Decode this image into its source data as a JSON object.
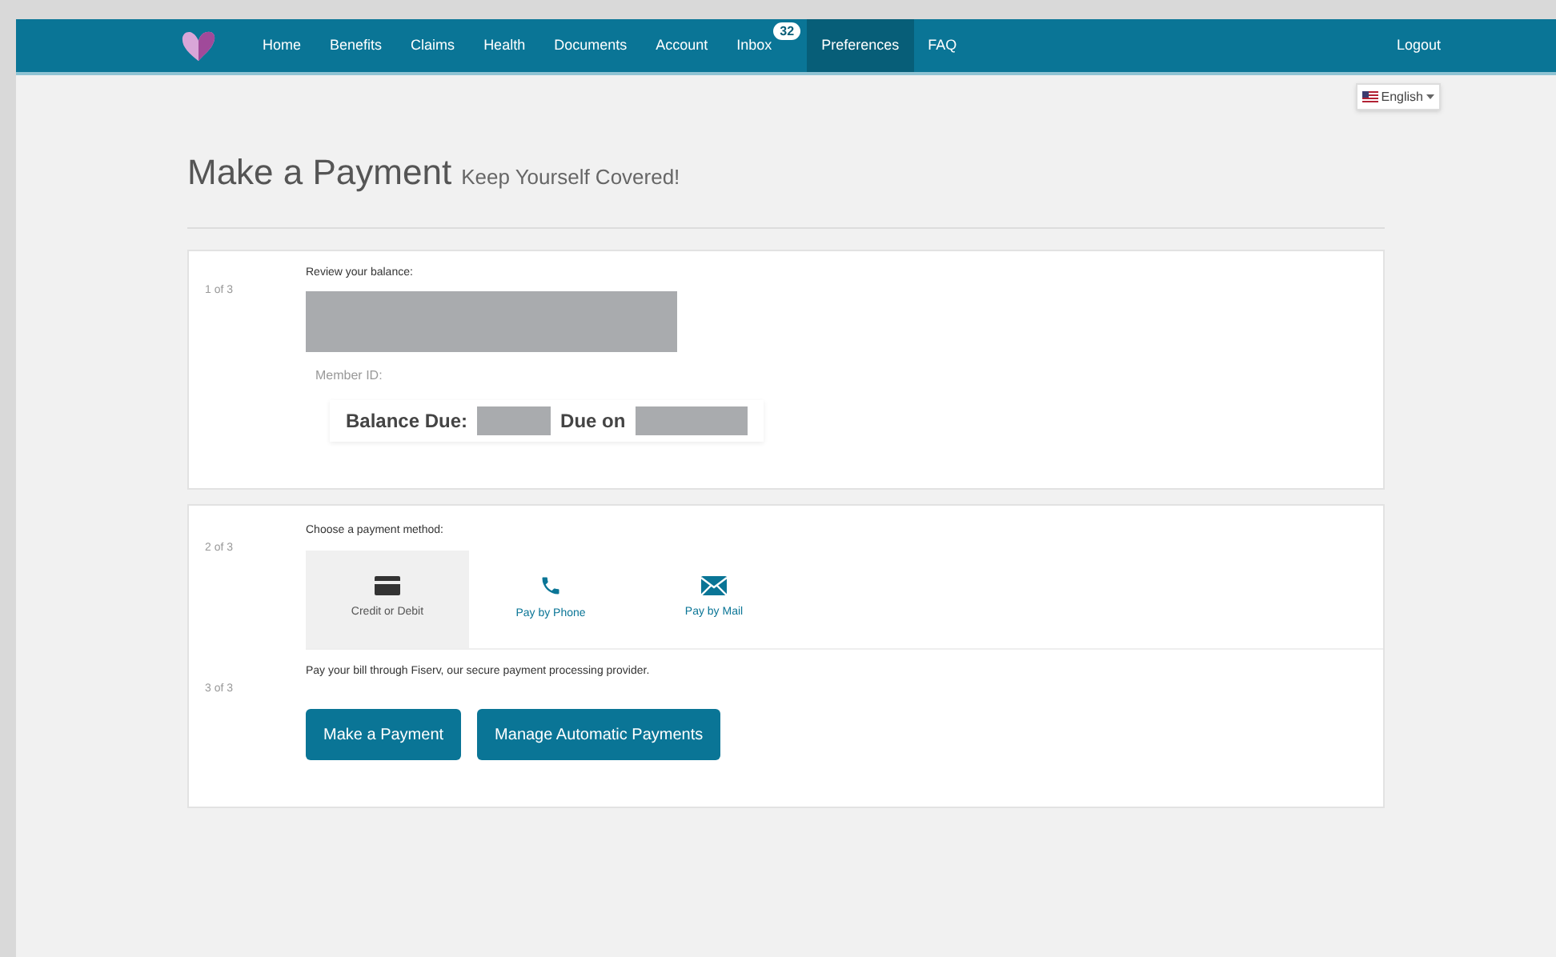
{
  "nav": {
    "items": [
      {
        "label": "Home",
        "selected": false
      },
      {
        "label": "Benefits",
        "selected": false
      },
      {
        "label": "Claims",
        "selected": false
      },
      {
        "label": "Health",
        "selected": false
      },
      {
        "label": "Documents",
        "selected": false
      },
      {
        "label": "Account",
        "selected": false
      },
      {
        "label": "Inbox",
        "selected": false,
        "badge": "32"
      },
      {
        "label": "Preferences",
        "selected": true
      },
      {
        "label": "FAQ",
        "selected": false
      }
    ],
    "logout": "Logout"
  },
  "language": {
    "value": "English"
  },
  "page": {
    "title": "Make a Payment",
    "subtitle": "Keep Yourself Covered!"
  },
  "step1": {
    "step": "1 of 3",
    "heading": "Review your balance:",
    "member_id_label": "Member ID:",
    "balance_label": "Balance Due:",
    "due_label": "Due on"
  },
  "step2": {
    "step": "2 of 3",
    "heading": "Choose a payment method:",
    "methods": [
      {
        "kind": "card",
        "label": "Credit or Debit",
        "selected": true
      },
      {
        "kind": "phone",
        "label": "Pay by Phone",
        "selected": false
      },
      {
        "kind": "mail",
        "label": "Pay by Mail",
        "selected": false
      }
    ]
  },
  "step3": {
    "step": "3 of 3",
    "text": "Pay your bill through Fiserv, our secure payment processing provider.",
    "buttons": [
      "Make a Payment",
      "Manage Automatic Payments"
    ]
  }
}
